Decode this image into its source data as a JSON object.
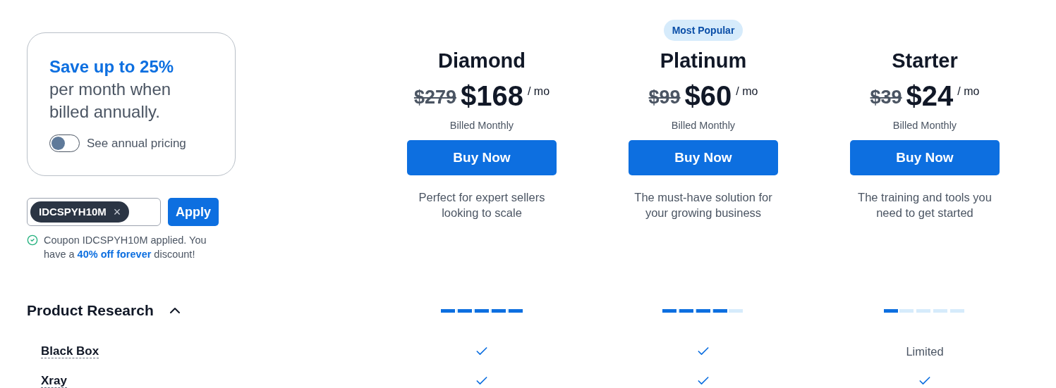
{
  "promo": {
    "headline": "Save up to 25%",
    "text": "per month when billed annually.",
    "toggle": {
      "label": "See annual pricing",
      "on": false
    }
  },
  "coupon": {
    "code": "IDCSPYH10M",
    "remove": "×",
    "button": "Apply",
    "message": "Coupon IDCSPYH10M applied. You have a **40% off forever** discount!"
  },
  "plans": [
    {
      "name": "Diamond",
      "old_price": "$279",
      "price": "$168",
      "period": "/ mo",
      "billing": "Billed Monthly",
      "button": "Buy Now",
      "description": "Perfect for expert sellers looking to scale",
      "level": 1
    },
    {
      "name": "Platinum",
      "badge": "Most Popular",
      "old_price": "$99",
      "price": "$60",
      "period": "/ mo",
      "billing": "Billed Monthly",
      "button": "Buy Now",
      "description": "The must-have solution for your growing business",
      "level": 0.8
    },
    {
      "name": "Starter",
      "old_price": "$39",
      "price": "$24",
      "period": "/ mo",
      "billing": "Billed Monthly",
      "button": "Buy Now",
      "description": "The training and tools you need to get started",
      "level": 0.2
    }
  ],
  "section": {
    "title": "Product Research",
    "expanded": true
  },
  "features": [
    {
      "name": "Black Box",
      "cells": [
        {
          "kind": "check"
        },
        {
          "kind": "check"
        },
        {
          "kind": "text",
          "text": "Limited"
        }
      ]
    },
    {
      "name": "Xray",
      "cells": [
        {
          "kind": "check"
        },
        {
          "kind": "check"
        },
        {
          "kind": "check"
        }
      ]
    }
  ]
}
